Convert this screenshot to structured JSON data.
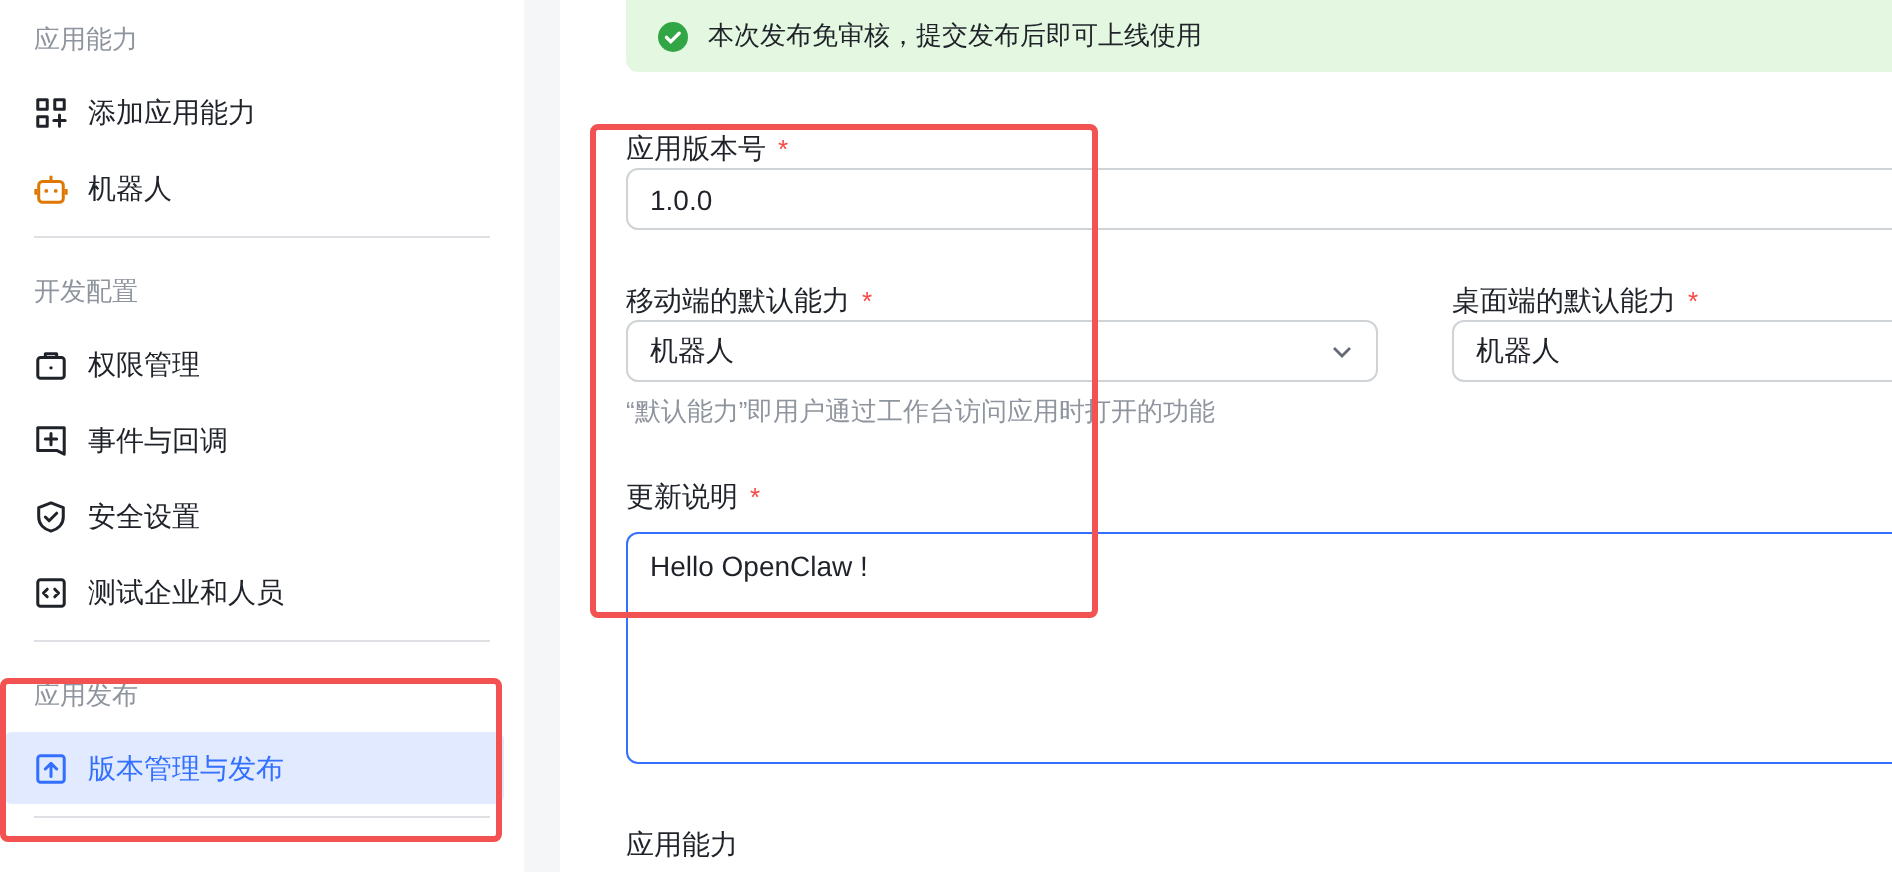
{
  "sidebar": {
    "sections": [
      {
        "title": "应用能力",
        "items": [
          {
            "label": "添加应用能力",
            "selected": false
          },
          {
            "label": "机器人",
            "selected": false
          }
        ]
      },
      {
        "title": "开发配置",
        "items": [
          {
            "label": "权限管理",
            "selected": false
          },
          {
            "label": "事件与回调",
            "selected": false
          },
          {
            "label": "安全设置",
            "selected": false
          },
          {
            "label": "测试企业和人员",
            "selected": false
          }
        ]
      },
      {
        "title": "应用发布",
        "items": [
          {
            "label": "版本管理与发布",
            "selected": true
          }
        ]
      }
    ]
  },
  "notice": {
    "text": "本次发布免审核，提交发布后即可上线使用"
  },
  "version": {
    "label": "应用版本号",
    "required_mark": "*",
    "value": "1.0.0"
  },
  "defaults": [
    {
      "label": "移动端的默认能力",
      "required_mark": "*",
      "value": "机器人"
    },
    {
      "label": "桌面端的默认能力",
      "required_mark": "*",
      "value": "机器人"
    }
  ],
  "defaults_hint": "“默认能力”即用户通过工作台访问应用时打开的功能",
  "notes": {
    "label": "更新说明",
    "required_mark": "*",
    "value": "Hello OpenClaw !",
    "focused": true
  },
  "next_section": "应用能力"
}
